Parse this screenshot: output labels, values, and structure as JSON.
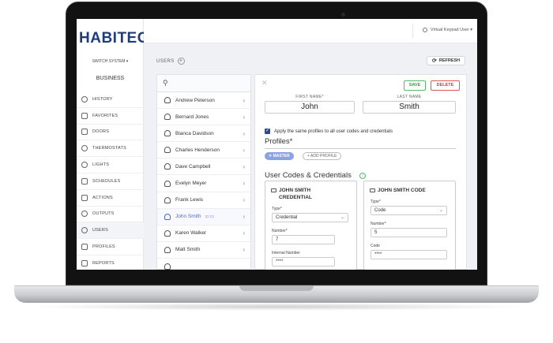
{
  "app": {
    "logo_text": "HABITEC",
    "system_switch": "SWITCH SYSTEM ▾",
    "system_name": "BUSINESS",
    "user_menu": "Virtual Keypad User ▾"
  },
  "sidebar": {
    "items": [
      {
        "label": "HISTORY",
        "icon": "history-icon"
      },
      {
        "label": "FAVORITES",
        "icon": "star-icon"
      },
      {
        "label": "DOORS",
        "icon": "door-icon"
      },
      {
        "label": "THERMOSTATS",
        "icon": "thermometer-icon"
      },
      {
        "label": "LIGHTS",
        "icon": "lightbulb-icon"
      },
      {
        "label": "SCHEDULES",
        "icon": "calendar-icon"
      },
      {
        "label": "ACTIONS",
        "icon": "actions-icon"
      },
      {
        "label": "OUTPUTS",
        "icon": "outputs-icon"
      },
      {
        "label": "USERS",
        "icon": "users-icon",
        "active": true
      },
      {
        "label": "PROFILES",
        "icon": "profiles-icon"
      },
      {
        "label": "REPORTS",
        "icon": "reports-icon"
      }
    ]
  },
  "main": {
    "title": "USERS",
    "add_symbol": "+",
    "refresh_label": "REFRESH"
  },
  "user_list": {
    "users": [
      "Andrew Peterson",
      "Bernard Jones",
      "Bianca Davidson",
      "Charles Henderson",
      "Dave Campbell",
      "Evelyn Meyer",
      "Frank Lewis",
      "John Smith",
      "Karen Walker",
      "Matt Smith"
    ],
    "selected_index": 7
  },
  "detail": {
    "close_symbol": "✕",
    "save_label": "SAVE",
    "delete_label": "DELETE",
    "first_name_label": "FIRST NAME*",
    "first_name": "John",
    "last_name_label": "LAST NAME",
    "last_name": "Smith",
    "apply_profiles_text": "Apply the same profiles to all user codes and credentials",
    "apply_profiles_checked": true,
    "profiles_title": "Profiles*",
    "profile_chip": "✕ MASTER",
    "add_profile_label": "+ ADD PROFILE",
    "codes_title": "User Codes & Credentials",
    "credential_card": {
      "title_line1": "JOHN SMITH",
      "title_line2": "CREDENTIAL",
      "type_label": "Type*",
      "type_value": "Credential",
      "number_label": "Number*",
      "number_value": "7",
      "internal_label": "Internal Number",
      "internal_value": "****"
    },
    "code_card": {
      "title": "JOHN SMITH CODE",
      "type_label": "Type*",
      "type_value": "Code",
      "number_label": "Number*",
      "number_value": "5",
      "code_label": "Code",
      "code_value": "****"
    }
  }
}
